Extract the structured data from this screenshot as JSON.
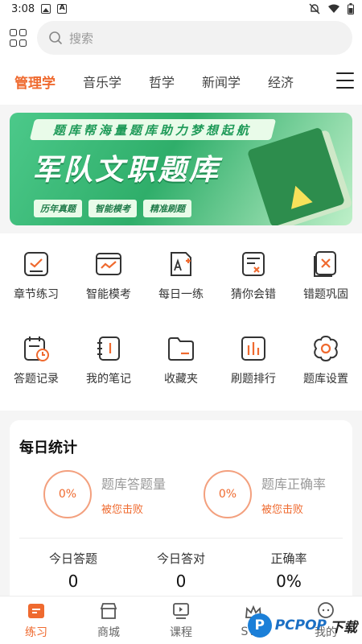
{
  "status_bar": {
    "time": "3:08"
  },
  "search": {
    "placeholder": "搜索"
  },
  "tabs": [
    {
      "label": "管理学",
      "active": true
    },
    {
      "label": "音乐学"
    },
    {
      "label": "哲学"
    },
    {
      "label": "新闻学"
    },
    {
      "label": "经济"
    }
  ],
  "banner": {
    "slogan": "题库帮海量题库助力梦想起航",
    "title": "军队文职题库",
    "tags": [
      "历年真题",
      "智能模考",
      "精准刷题"
    ]
  },
  "features": {
    "row1": [
      {
        "label": "章节练习",
        "icon": "chapter-practice-icon"
      },
      {
        "label": "智能模考",
        "icon": "smart-exam-icon"
      },
      {
        "label": "每日一练",
        "icon": "daily-practice-icon"
      },
      {
        "label": "猜你会错",
        "icon": "guess-wrong-icon"
      },
      {
        "label": "错题巩固",
        "icon": "wrong-review-icon"
      }
    ],
    "row2": [
      {
        "label": "答题记录",
        "icon": "answer-record-icon"
      },
      {
        "label": "我的笔记",
        "icon": "notes-icon"
      },
      {
        "label": "收藏夹",
        "icon": "favorites-icon"
      },
      {
        "label": "刷题排行",
        "icon": "ranking-icon"
      },
      {
        "label": "题库设置",
        "icon": "settings-icon"
      }
    ]
  },
  "stats": {
    "title": "每日统计",
    "circle1": {
      "value": "0%",
      "label": "题库答题量",
      "sub": "被您击败"
    },
    "circle2": {
      "value": "0%",
      "label": "题库正确率",
      "sub": "被您击败"
    },
    "today": [
      {
        "label": "今日答题",
        "value": "0"
      },
      {
        "label": "今日答对",
        "value": "0"
      },
      {
        "label": "正确率",
        "value": "0%"
      }
    ]
  },
  "bottom_nav": [
    {
      "label": "练习",
      "active": true
    },
    {
      "label": "商城"
    },
    {
      "label": "课程"
    },
    {
      "label": "SVIP"
    },
    {
      "label": "我的"
    }
  ],
  "watermark": {
    "brand": "PCPOP",
    "suffix": "下载"
  },
  "colors": {
    "accent": "#ef6a2f",
    "banner_green": "#2fae6a"
  }
}
